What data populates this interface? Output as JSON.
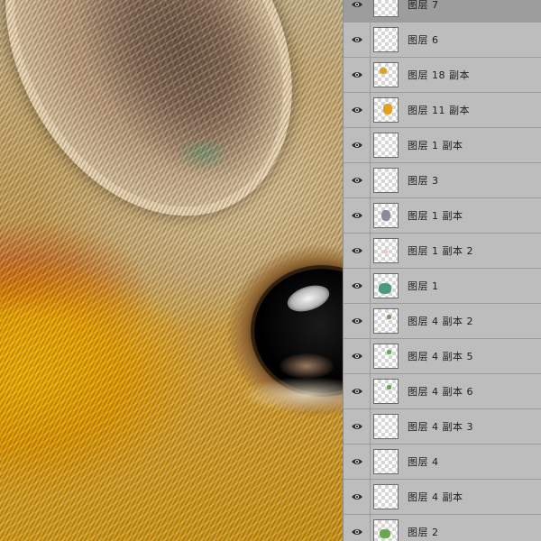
{
  "layers_panel": {
    "layers": [
      {
        "name": "图层 7",
        "visible": true,
        "selected": true,
        "thumb": ""
      },
      {
        "name": "图层 6",
        "visible": true,
        "selected": false,
        "thumb": ""
      },
      {
        "name": "图层 18 副本",
        "visible": true,
        "selected": false,
        "thumb": "orange"
      },
      {
        "name": "图层 11 副本",
        "visible": true,
        "selected": false,
        "thumb": "orange-large"
      },
      {
        "name": "图层 1 副本",
        "visible": true,
        "selected": false,
        "thumb": ""
      },
      {
        "name": "图层 3",
        "visible": true,
        "selected": false,
        "thumb": ""
      },
      {
        "name": "图层 1 副本",
        "visible": true,
        "selected": false,
        "thumb": "gray"
      },
      {
        "name": "图层 1 副本 2",
        "visible": true,
        "selected": false,
        "thumb": "faint"
      },
      {
        "name": "图层 1",
        "visible": true,
        "selected": false,
        "thumb": "teal"
      },
      {
        "name": "图层 4 副本 2",
        "visible": true,
        "selected": false,
        "thumb": "green-small"
      },
      {
        "name": "图层 4 副本 5",
        "visible": true,
        "selected": false,
        "thumb": "green-small"
      },
      {
        "name": "图层 4 副本 6",
        "visible": true,
        "selected": false,
        "thumb": "green-small"
      },
      {
        "name": "图层 4 副本 3",
        "visible": true,
        "selected": false,
        "thumb": ""
      },
      {
        "name": "图层 4",
        "visible": true,
        "selected": false,
        "thumb": ""
      },
      {
        "name": "图层 4 副本",
        "visible": true,
        "selected": false,
        "thumb": ""
      },
      {
        "name": "图层 2",
        "visible": true,
        "selected": false,
        "thumb": "green"
      }
    ]
  },
  "colors": {
    "panel_bg": "#bdbdbd",
    "selected_row": "#9d9d9d",
    "thumb_orange": "#e0a020",
    "thumb_teal": "#4a9a80",
    "thumb_green": "#6aa84f",
    "thumb_gray": "#8a8aa0"
  },
  "icons": {
    "visibility": "eye-icon"
  }
}
